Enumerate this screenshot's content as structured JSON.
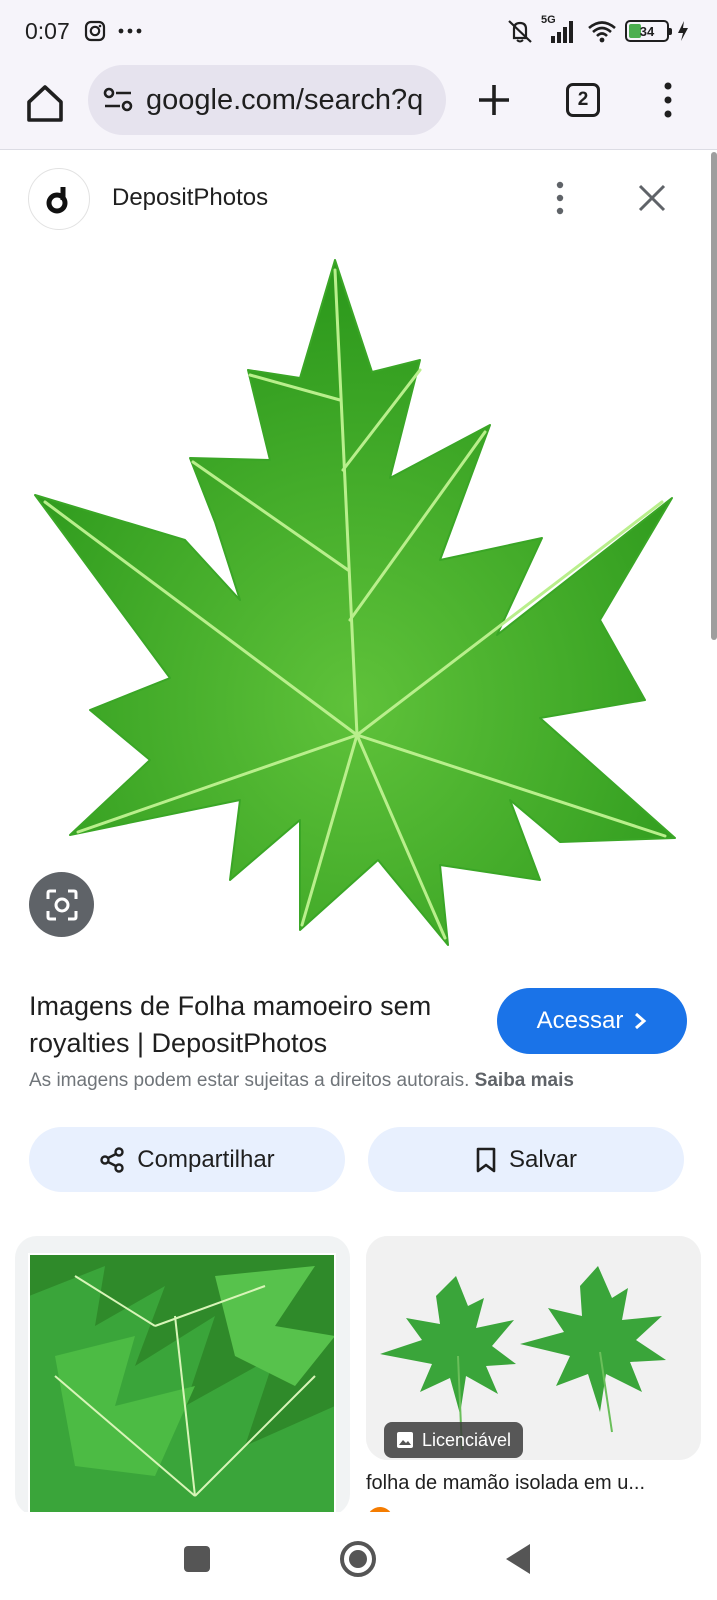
{
  "status_bar": {
    "time": "0:07",
    "network": "5G",
    "battery": "34",
    "battery_percent": 34,
    "icons": [
      "instagram-icon",
      "more-dots-icon",
      "mute-icon",
      "signal-icon",
      "wifi-icon",
      "battery-icon",
      "charging-icon"
    ]
  },
  "browser": {
    "url": "google.com/search?q",
    "tab_count": "2",
    "icons": [
      "home-icon",
      "site-settings-icon",
      "new-tab-icon",
      "tab-switcher-icon",
      "menu-icon"
    ]
  },
  "source": {
    "name": "DepositPhotos",
    "icons": [
      "source-logo-icon",
      "more-options-icon",
      "close-icon"
    ]
  },
  "result": {
    "title": "Imagens de Folha mamoeiro sem royalties | DepositPhotos",
    "visit_label": "Acessar",
    "copyright_text": "As imagens podem estar sujeitas a direitos autorais.",
    "learn_more": "Saiba mais",
    "share_label": "Compartilhar",
    "save_label": "Salvar"
  },
  "related": {
    "badge": "Licenciável",
    "caption": "folha de mamão isolada em u..."
  },
  "colors": {
    "accent": "#1a73e8",
    "chip_bg": "#e8f0fe",
    "leaf": "#4caf50"
  }
}
